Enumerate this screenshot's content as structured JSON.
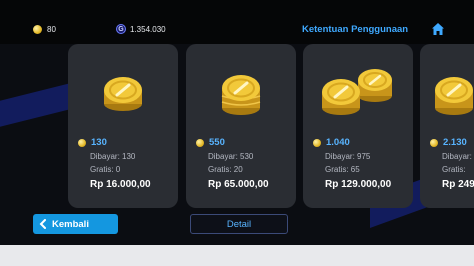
{
  "header": {
    "coins": "80",
    "gems": "1.354.030",
    "gem_glyph": "G",
    "terms_label": "Ketentuan Penggunaan"
  },
  "packages": [
    {
      "amount": "130",
      "paid": "Dibayar: 130",
      "free": "Gratis: 0",
      "price": "Rp 16.000,00"
    },
    {
      "amount": "550",
      "paid": "Dibayar: 530",
      "free": "Gratis: 20",
      "price": "Rp 65.000,00"
    },
    {
      "amount": "1.040",
      "paid": "Dibayar: 975",
      "free": "Gratis: 65",
      "price": "Rp 129.000,00"
    },
    {
      "amount": "2.130",
      "paid": "Dibayar:",
      "free": "Gratis:",
      "price": "Rp 249"
    }
  ],
  "footer": {
    "back_label": "Kembali",
    "detail_label": "Detail"
  },
  "colors": {
    "accent": "#1497e0",
    "amount_text": "#58b4ff",
    "card_bg": "#2a2d33",
    "page_bg": "#0b0d12"
  },
  "icons": [
    "coin-icon",
    "gem-icon",
    "home-icon",
    "chevron-left-icon"
  ]
}
